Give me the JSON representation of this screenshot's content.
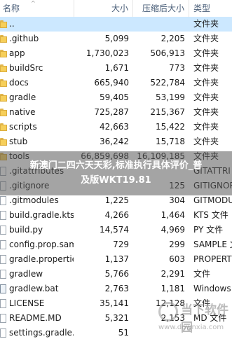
{
  "columns": {
    "name": "名称",
    "size": "大小",
    "compressed": "压缩后大小",
    "type": "类型"
  },
  "rows": [
    {
      "name": "..",
      "size": "",
      "compressed": "",
      "type": "文件夹",
      "icon": "folder-icon",
      "selected": true
    },
    {
      "name": ".github",
      "size": "5,099",
      "compressed": "2,205",
      "type": "文件夹",
      "icon": "folder-icon"
    },
    {
      "name": "app",
      "size": "1,730,023",
      "compressed": "506,913",
      "type": "文件夹",
      "icon": "folder-icon"
    },
    {
      "name": "buildSrc",
      "size": "1,671",
      "compressed": "773",
      "type": "文件夹",
      "icon": "folder-icon"
    },
    {
      "name": "docs",
      "size": "665,940",
      "compressed": "522,784",
      "type": "文件夹",
      "icon": "folder-icon"
    },
    {
      "name": "gradle",
      "size": "59,405",
      "compressed": "53,199",
      "type": "文件夹",
      "icon": "folder-icon"
    },
    {
      "name": "native",
      "size": "725,287",
      "compressed": "215,367",
      "type": "文件夹",
      "icon": "folder-icon"
    },
    {
      "name": "scripts",
      "size": "42,663",
      "compressed": "15,422",
      "type": "文件夹",
      "icon": "folder-icon"
    },
    {
      "name": "stub",
      "size": "36,242",
      "compressed": "15,718",
      "type": "文件夹",
      "icon": "folder-icon"
    },
    {
      "name": "tools",
      "size": "66,859,698",
      "compressed": "16,109,185",
      "type": "文件夹",
      "icon": "folder-icon"
    },
    {
      "name": ".gitattributes",
      "size": "",
      "compressed": "",
      "type": "GITATTRI",
      "icon": "file-icon"
    },
    {
      "name": ".gitignore",
      "size": "",
      "compressed": "125",
      "type": "GITIGNOR",
      "icon": "file-icon"
    },
    {
      "name": ".gitmodules",
      "size": "1,225",
      "compressed": "304",
      "type": "GITMODUL",
      "icon": "file-icon"
    },
    {
      "name": "build.gradle.kts",
      "size": "4,266",
      "compressed": "1,464",
      "type": "KTS 文件",
      "icon": "file-icon"
    },
    {
      "name": "build.py",
      "size": "14,574",
      "compressed": "4,969",
      "type": "PY 文件",
      "icon": "file-icon"
    },
    {
      "name": "config.prop.sample",
      "size": "729",
      "compressed": "299",
      "type": "SAMPLE 文",
      "icon": "file-icon"
    },
    {
      "name": "gradle.properties",
      "size": "1,137",
      "compressed": "603",
      "type": "PROPERT",
      "icon": "file-icon"
    },
    {
      "name": "gradlew",
      "size": "5,766",
      "compressed": "2,291",
      "type": "文件",
      "icon": "file-icon"
    },
    {
      "name": "gradlew.bat",
      "size": "2,763",
      "compressed": "1,181",
      "type": "Windows",
      "icon": "bat-file-icon"
    },
    {
      "name": "LICENSE",
      "size": "35,141",
      "compressed": "12,128",
      "type": "文件",
      "icon": "file-icon"
    },
    {
      "name": "README.MD",
      "size": "5,321",
      "compressed": "2,153",
      "type": "MD 文件",
      "icon": "file-icon"
    },
    {
      "name": "settings.gradle.kts",
      "size": "51",
      "compressed": "",
      "type": "",
      "icon": "file-icon"
    }
  ],
  "overlay": {
    "line1": "新澳门二四六天天彩,标准执行具体评价_普",
    "line2": "及版WKT19.81"
  },
  "watermark": {
    "text": "当下软件园",
    "url": "www.downxia.com"
  }
}
